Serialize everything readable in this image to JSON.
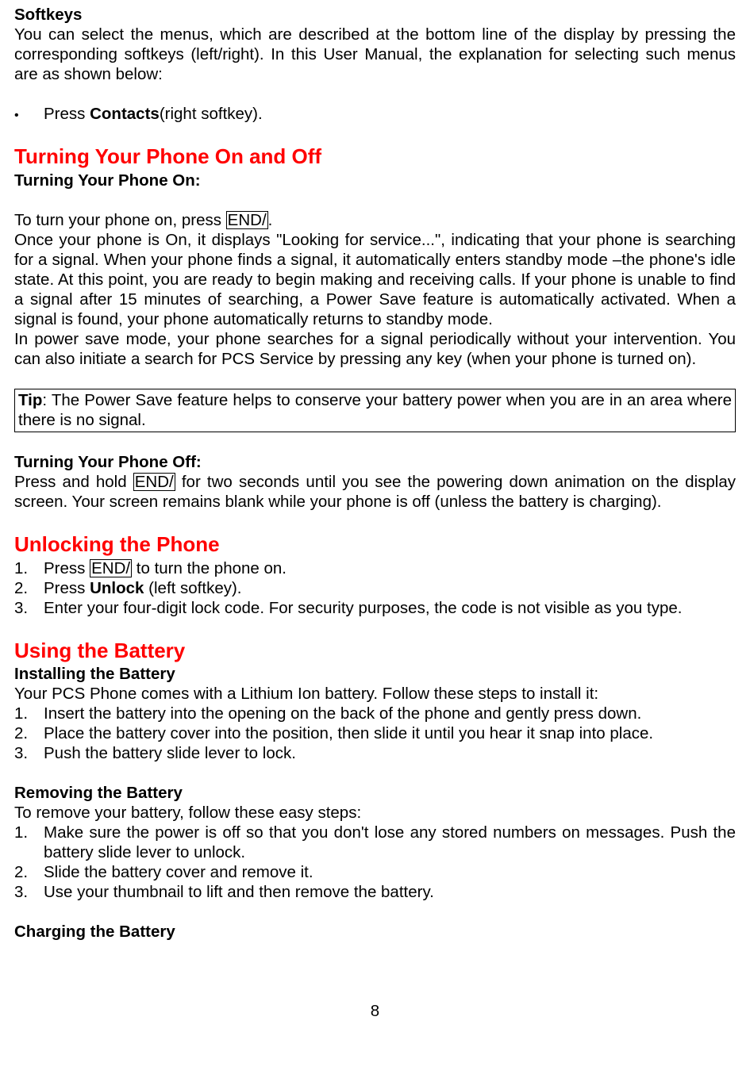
{
  "softkeys": {
    "heading": "Softkeys",
    "text": "You can select the menus, which are described at the bottom line of the display by pressing the corresponding softkeys (left/right). In this User Manual, the explanation for selecting such menus are as shown below:",
    "bullet_prefix": "Press ",
    "bullet_bold": "Contacts",
    "bullet_suffix": "(right softkey)."
  },
  "turning": {
    "heading": "Turning Your Phone On and Off",
    "on_heading": "Turning Your Phone On:",
    "on_p1_prefix": "To turn your phone on, press ",
    "on_p1_key": "END/",
    "on_p1_suffix": ".",
    "on_p2": "Once your phone is On, it displays \"Looking for service...\", indicating that your phone is searching for a signal. When your phone finds a signal, it automatically enters standby mode –the phone's idle state. At this point, you are ready to begin making and receiving calls. If your phone is unable to find a signal after 15 minutes of searching, a Power Save feature is automatically activated. When a signal is found, your phone automatically returns to standby mode.",
    "on_p3": "In power save mode, your phone searches for a signal periodically without your intervention. You can also initiate a search for PCS Service by pressing any key (when your phone is turned on).",
    "tip_label": "Tip",
    "tip_text": ": The Power Save feature helps to conserve your battery power when you are in an area where there is no signal.",
    "off_heading": "Turning Your Phone Off:",
    "off_p_prefix": "Press and hold ",
    "off_p_key": "END/",
    "off_p_suffix": " for two seconds until you see the powering down animation on the display screen. Your screen remains blank while your phone is off (unless the battery is charging)."
  },
  "unlocking": {
    "heading": "Unlocking the Phone",
    "item1_prefix": "Press ",
    "item1_key": "END/",
    "item1_suffix": " to turn the phone on.",
    "item2_prefix": "Press ",
    "item2_bold": "Unlock",
    "item2_suffix": " (left softkey).",
    "item3": "Enter your four-digit lock code. For security purposes, the code is not visible as you type."
  },
  "battery": {
    "heading": "Using the Battery",
    "install_heading": "Installing the Battery",
    "install_intro": "Your PCS Phone comes with a Lithium Ion battery. Follow these steps to install it:",
    "install_1": "Insert the battery into the opening on the back of the phone and gently press down.",
    "install_2": "Place the battery cover into the position, then slide it until you hear it snap into place.",
    "install_3": "Push the battery slide lever to lock.",
    "remove_heading": "Removing the Battery",
    "remove_intro": "To remove your battery, follow these easy steps:",
    "remove_1": "Make sure the power is off so that you don't lose any stored numbers on messages. Push the battery slide lever to unlock.",
    "remove_2": "Slide the battery cover and remove it.",
    "remove_3": "Use your thumbnail to lift and then remove the battery.",
    "charge_heading": "Charging the Battery"
  },
  "numbers": {
    "n1": "1.",
    "n2": "2.",
    "n3": "3."
  },
  "page_number": "8"
}
